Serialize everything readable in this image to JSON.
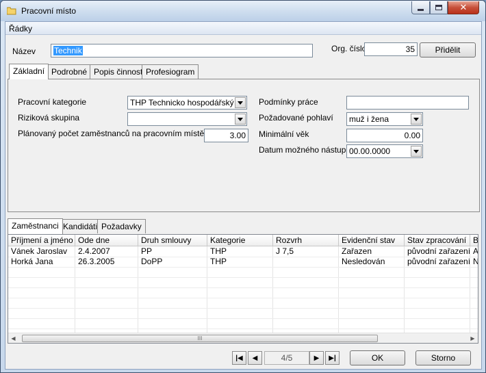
{
  "window": {
    "title": "Pracovní místo"
  },
  "menu": {
    "radky": "Řádky"
  },
  "header": {
    "nazev_label": "Název",
    "nazev_value": "Technik",
    "org_cislo_label": "Org. číslo",
    "org_cislo_value": "35",
    "pridelit_label": "Přidělit"
  },
  "tabs_top": [
    {
      "label": "Základní"
    },
    {
      "label": "Podrobné"
    },
    {
      "label": "Popis činnosti"
    },
    {
      "label": "Profesiogram"
    }
  ],
  "detail": {
    "pracovni_kategorie_label": "Pracovní kategorie",
    "pracovni_kategorie_value": "THP Technicko hospodářský pracovník",
    "rizikova_skupina_label": "Riziková skupina",
    "rizikova_skupina_value": "",
    "planovany_pocet_label": "Plánovaný počet zaměstnanců na pracovním místě",
    "planovany_pocet_value": "3.00",
    "podminky_prace_label": "Podmínky práce",
    "podminky_prace_value": "",
    "pozadovane_pohlavi_label": "Požadované pohlaví",
    "pozadovane_pohlavi_value": "muž i žena",
    "minimalni_vek_label": "Minimální věk",
    "minimalni_vek_value": "0.00",
    "datum_nastupu_label": "Datum možného nástupu",
    "datum_nastupu_value": "00.00.0000"
  },
  "tabs_bottom": [
    {
      "label": "Zaměstnanci"
    },
    {
      "label": "Kandidáti"
    },
    {
      "label": "Požadavky"
    }
  ],
  "grid": {
    "columns": [
      "Příjmení a jméno",
      "Ode dne",
      "Druh smlouvy",
      "Kategorie",
      "Rozvrh",
      "Evidenční stav",
      "Stav zpracování",
      "B"
    ],
    "rows": [
      [
        "Vánek Jaroslav",
        "2.4.2007",
        "PP",
        "THP",
        "J 7,5",
        "Zařazen",
        "původní zařazení",
        "A"
      ],
      [
        "Horká Jana",
        "26.3.2005",
        "DoPP",
        "THP",
        "",
        "Nesledován",
        "původní zařazení",
        "N"
      ]
    ],
    "scroll_thumb_grip": "III"
  },
  "navigation": {
    "counter": "4/5"
  },
  "buttons": {
    "ok": "OK",
    "storno": "Storno"
  },
  "colors": {
    "selection": "#3399ff",
    "close_button": "#c7503a",
    "titlebar": "#cfdeef"
  }
}
